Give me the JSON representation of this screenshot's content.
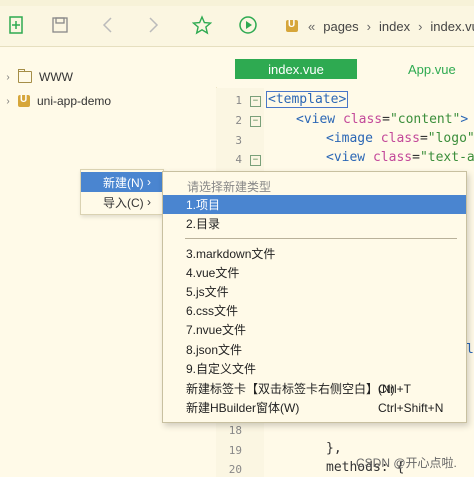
{
  "toolbar": {
    "breadcrumb": [
      "pages",
      "index",
      "index.vu"
    ]
  },
  "sidebar": {
    "items": [
      {
        "label": "WWW"
      },
      {
        "label": "uni-app-demo"
      }
    ]
  },
  "editor": {
    "tabs": [
      {
        "label": "index.vue",
        "active": true
      },
      {
        "label": "App.vue",
        "active": false
      }
    ],
    "line_numbers": [
      "1",
      "2",
      "3",
      "4",
      "18",
      "19",
      "20"
    ]
  },
  "context_menu": {
    "items": [
      {
        "label": "新建(N)",
        "has_submenu": true,
        "selected": true
      },
      {
        "label": "导入(C)",
        "has_submenu": true,
        "selected": false
      }
    ]
  },
  "submenu": {
    "hint": "请选择新建类型",
    "items": [
      {
        "label": "1.项目",
        "shortcut": "",
        "highlighted": true
      },
      {
        "label": "2.目录",
        "shortcut": ""
      },
      {
        "label": "3.markdown文件",
        "shortcut": ""
      },
      {
        "label": "4.vue文件",
        "shortcut": ""
      },
      {
        "label": "5.js文件",
        "shortcut": ""
      },
      {
        "label": "6.css文件",
        "shortcut": ""
      },
      {
        "label": "7.nvue文件",
        "shortcut": ""
      },
      {
        "label": "8.json文件",
        "shortcut": ""
      },
      {
        "label": "9.自定义文件",
        "shortcut": ""
      },
      {
        "label": "新建标签卡【双击标签卡右侧空白】(N)",
        "shortcut": "Ctrl+T"
      },
      {
        "label": "新建HBuilder窗体(W)",
        "shortcut": "Ctrl+Shift+N"
      }
    ]
  },
  "watermark": "CSDN @开心点啦."
}
